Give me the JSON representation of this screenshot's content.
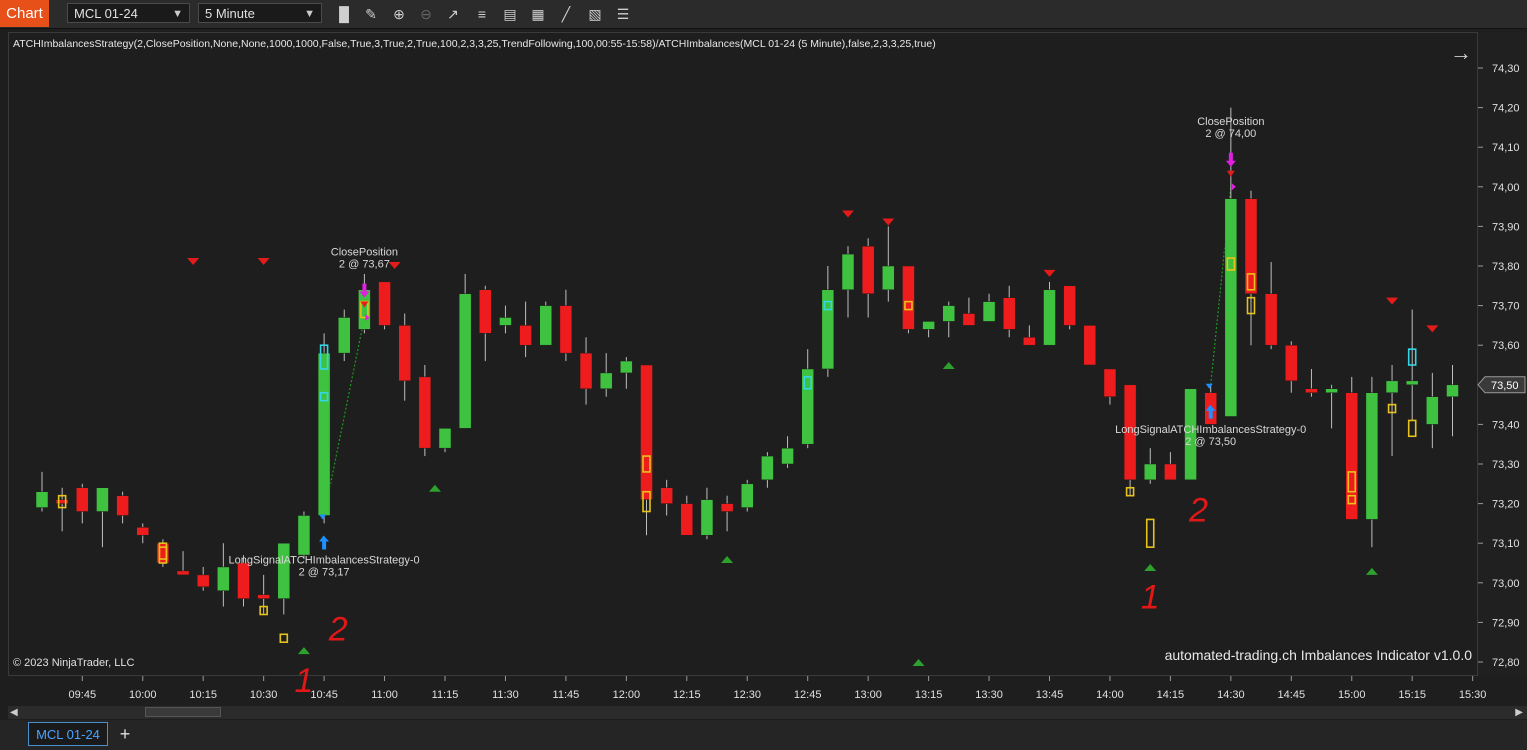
{
  "toolbar": {
    "chart_tab_label": "Chart",
    "instrument_value": "MCL 01-24",
    "interval_value": "5 Minute",
    "tools": [
      "bar-type-icon",
      "draw-pencil-icon",
      "zoom-in-icon",
      "zoom-out-icon",
      "pointer-icon",
      "properties-icon",
      "data-box-icon",
      "indicators-icon",
      "strategies-icon",
      "templates-icon",
      "more-menu-icon"
    ]
  },
  "chart_header": {
    "strategy_title": "ATCHImbalancesStrategy(2,ClosePosition,None,None,1000,1000,False,True,3,True,2,True,100,2,3,3,25,TrendFollowing,100,00:55-15:58)/ATCHImbalances(MCL 01-24 (5 Minute),false,2,3,3,25,true)"
  },
  "footer": {
    "copyright": "© 2023 NinjaTrader, LLC",
    "indicator_label": "automated-trading.ch Imbalances Indicator v1.0.0"
  },
  "bottom_tabs": {
    "instrument_tab": "MCL 01-24",
    "add_tab": "+"
  },
  "colors": {
    "up": "#3fc23f",
    "down": "#ee1c1c",
    "imbalance_yellow": "#e6c21a",
    "imbalance_cyan": "#33d6e6",
    "signal_up": "#1e90ff",
    "exit_marker": "#e21ee2",
    "triangle_down": "#e31b1b",
    "triangle_up": "#2ea02e",
    "annotation_red": "#e01818"
  },
  "chart_data": {
    "type": "candlestick",
    "interval": "5 Minute",
    "instrument": "MCL 01-24",
    "ylim": [
      72.77,
      74.35
    ],
    "y_ticks": [
      "74,30",
      "74,20",
      "74,10",
      "74,00",
      "73,90",
      "73,80",
      "73,70",
      "73,60",
      "73,50",
      "73,40",
      "73,30",
      "73,20",
      "73,10",
      "73,00",
      "72,90",
      "72,80"
    ],
    "last_price_label": "73,50",
    "last_price": 73.5,
    "x_ticks": [
      "09:45",
      "10:00",
      "10:15",
      "10:30",
      "10:45",
      "11:00",
      "11:15",
      "11:30",
      "11:45",
      "12:00",
      "12:15",
      "12:30",
      "12:45",
      "13:00",
      "13:15",
      "13:30",
      "13:45",
      "14:00",
      "14:15",
      "14:30",
      "14:45",
      "15:00",
      "15:15",
      "15:30"
    ],
    "first_bar_time": "09:35",
    "bar_minutes": 5,
    "candles": [
      {
        "o": 73.19,
        "h": 73.28,
        "l": 73.18,
        "c": 73.23
      },
      {
        "o": 73.21,
        "h": 73.24,
        "l": 73.13,
        "c": 73.2
      },
      {
        "o": 73.24,
        "h": 73.25,
        "l": 73.15,
        "c": 73.18
      },
      {
        "o": 73.18,
        "h": 73.23,
        "l": 73.09,
        "c": 73.24
      },
      {
        "o": 73.22,
        "h": 73.23,
        "l": 73.15,
        "c": 73.17
      },
      {
        "o": 73.14,
        "h": 73.15,
        "l": 73.1,
        "c": 73.12
      },
      {
        "o": 73.1,
        "h": 73.11,
        "l": 73.04,
        "c": 73.05
      },
      {
        "o": 73.03,
        "h": 73.08,
        "l": 73.02,
        "c": 73.02
      },
      {
        "o": 73.02,
        "h": 73.04,
        "l": 72.98,
        "c": 72.99
      },
      {
        "o": 72.98,
        "h": 73.1,
        "l": 72.94,
        "c": 73.04
      },
      {
        "o": 73.05,
        "h": 73.07,
        "l": 72.94,
        "c": 72.96
      },
      {
        "o": 72.97,
        "h": 73.02,
        "l": 72.92,
        "c": 72.96
      },
      {
        "o": 72.96,
        "h": 73.1,
        "l": 72.92,
        "c": 73.1
      },
      {
        "o": 73.07,
        "h": 73.18,
        "l": 73.06,
        "c": 73.17
      },
      {
        "o": 73.17,
        "h": 73.63,
        "l": 73.15,
        "c": 73.58
      },
      {
        "o": 73.58,
        "h": 73.69,
        "l": 73.56,
        "c": 73.67
      },
      {
        "o": 73.64,
        "h": 73.78,
        "l": 73.63,
        "c": 73.74
      },
      {
        "o": 73.76,
        "h": 73.76,
        "l": 73.64,
        "c": 73.65
      },
      {
        "o": 73.65,
        "h": 73.68,
        "l": 73.46,
        "c": 73.51
      },
      {
        "o": 73.52,
        "h": 73.55,
        "l": 73.32,
        "c": 73.34
      },
      {
        "o": 73.34,
        "h": 73.39,
        "l": 73.33,
        "c": 73.39
      },
      {
        "o": 73.39,
        "h": 73.78,
        "l": 73.39,
        "c": 73.73
      },
      {
        "o": 73.74,
        "h": 73.75,
        "l": 73.56,
        "c": 73.63
      },
      {
        "o": 73.65,
        "h": 73.7,
        "l": 73.63,
        "c": 73.67
      },
      {
        "o": 73.65,
        "h": 73.71,
        "l": 73.57,
        "c": 73.6
      },
      {
        "o": 73.6,
        "h": 73.71,
        "l": 73.6,
        "c": 73.7
      },
      {
        "o": 73.7,
        "h": 73.74,
        "l": 73.56,
        "c": 73.58
      },
      {
        "o": 73.58,
        "h": 73.62,
        "l": 73.45,
        "c": 73.49
      },
      {
        "o": 73.49,
        "h": 73.58,
        "l": 73.47,
        "c": 73.53
      },
      {
        "o": 73.53,
        "h": 73.57,
        "l": 73.49,
        "c": 73.56
      },
      {
        "o": 73.55,
        "h": 73.55,
        "l": 73.12,
        "c": 73.21
      },
      {
        "o": 73.24,
        "h": 73.26,
        "l": 73.17,
        "c": 73.2
      },
      {
        "o": 73.2,
        "h": 73.22,
        "l": 73.15,
        "c": 73.12
      },
      {
        "o": 73.12,
        "h": 73.24,
        "l": 73.11,
        "c": 73.21
      },
      {
        "o": 73.2,
        "h": 73.22,
        "l": 73.13,
        "c": 73.18
      },
      {
        "o": 73.19,
        "h": 73.26,
        "l": 73.18,
        "c": 73.25
      },
      {
        "o": 73.26,
        "h": 73.33,
        "l": 73.24,
        "c": 73.32
      },
      {
        "o": 73.3,
        "h": 73.37,
        "l": 73.29,
        "c": 73.34
      },
      {
        "o": 73.35,
        "h": 73.59,
        "l": 73.34,
        "c": 73.54
      },
      {
        "o": 73.54,
        "h": 73.8,
        "l": 73.52,
        "c": 73.74
      },
      {
        "o": 73.74,
        "h": 73.85,
        "l": 73.67,
        "c": 73.83
      },
      {
        "o": 73.85,
        "h": 73.87,
        "l": 73.67,
        "c": 73.73
      },
      {
        "o": 73.74,
        "h": 73.9,
        "l": 73.71,
        "c": 73.8
      },
      {
        "o": 73.8,
        "h": 73.8,
        "l": 73.63,
        "c": 73.64
      },
      {
        "o": 73.64,
        "h": 73.66,
        "l": 73.62,
        "c": 73.66
      },
      {
        "o": 73.66,
        "h": 73.71,
        "l": 73.62,
        "c": 73.7
      },
      {
        "o": 73.68,
        "h": 73.72,
        "l": 73.65,
        "c": 73.65
      },
      {
        "o": 73.66,
        "h": 73.73,
        "l": 73.66,
        "c": 73.71
      },
      {
        "o": 73.72,
        "h": 73.75,
        "l": 73.62,
        "c": 73.64
      },
      {
        "o": 73.62,
        "h": 73.65,
        "l": 73.61,
        "c": 73.6
      },
      {
        "o": 73.6,
        "h": 73.76,
        "l": 73.6,
        "c": 73.74
      },
      {
        "o": 73.75,
        "h": 73.75,
        "l": 73.64,
        "c": 73.65
      },
      {
        "o": 73.65,
        "h": 73.65,
        "l": 73.55,
        "c": 73.55
      },
      {
        "o": 73.54,
        "h": 73.54,
        "l": 73.45,
        "c": 73.47
      },
      {
        "o": 73.5,
        "h": 73.5,
        "l": 73.22,
        "c": 73.26
      },
      {
        "o": 73.26,
        "h": 73.34,
        "l": 73.25,
        "c": 73.3
      },
      {
        "o": 73.3,
        "h": 73.33,
        "l": 73.26,
        "c": 73.26
      },
      {
        "o": 73.26,
        "h": 73.49,
        "l": 73.26,
        "c": 73.49
      },
      {
        "o": 73.48,
        "h": 73.5,
        "l": 73.4,
        "c": 73.4
      },
      {
        "o": 73.42,
        "h": 74.2,
        "l": 73.42,
        "c": 73.97
      },
      {
        "o": 73.97,
        "h": 73.99,
        "l": 73.6,
        "c": 73.73
      },
      {
        "o": 73.73,
        "h": 73.81,
        "l": 73.59,
        "c": 73.6
      },
      {
        "o": 73.6,
        "h": 73.61,
        "l": 73.48,
        "c": 73.51
      },
      {
        "o": 73.49,
        "h": 73.54,
        "l": 73.47,
        "c": 73.48
      },
      {
        "o": 73.48,
        "h": 73.5,
        "l": 73.39,
        "c": 73.49
      },
      {
        "o": 73.48,
        "h": 73.52,
        "l": 73.16,
        "c": 73.16
      },
      {
        "o": 73.16,
        "h": 73.52,
        "l": 73.09,
        "c": 73.48
      },
      {
        "o": 73.48,
        "h": 73.55,
        "l": 73.32,
        "c": 73.51
      },
      {
        "o": 73.5,
        "h": 73.69,
        "l": 73.41,
        "c": 73.51
      },
      {
        "o": 73.4,
        "h": 73.53,
        "l": 73.34,
        "c": 73.47
      },
      {
        "o": 73.47,
        "h": 73.55,
        "l": 73.37,
        "c": 73.5
      }
    ],
    "imbalance_boxes": [
      {
        "bar": 1,
        "lo": 73.19,
        "hi": 73.22,
        "color": "yellow"
      },
      {
        "bar": 6,
        "lo": 73.05,
        "hi": 73.09,
        "color": "yellow"
      },
      {
        "bar": 6,
        "lo": 73.06,
        "hi": 73.1,
        "color": "yellow"
      },
      {
        "bar": 11,
        "lo": 72.92,
        "hi": 72.94,
        "color": "yellow"
      },
      {
        "bar": 12,
        "lo": 72.85,
        "hi": 72.87,
        "color": "yellow"
      },
      {
        "bar": 14,
        "lo": 73.54,
        "hi": 73.6,
        "color": "cyan"
      },
      {
        "bar": 14,
        "lo": 73.46,
        "hi": 73.48,
        "color": "cyan"
      },
      {
        "bar": 16,
        "lo": 73.67,
        "hi": 73.71,
        "color": "yellow"
      },
      {
        "bar": 30,
        "lo": 73.28,
        "hi": 73.32,
        "color": "yellow"
      },
      {
        "bar": 30,
        "lo": 73.18,
        "hi": 73.23,
        "color": "yellow"
      },
      {
        "bar": 39,
        "lo": 73.69,
        "hi": 73.71,
        "color": "cyan"
      },
      {
        "bar": 38,
        "lo": 73.49,
        "hi": 73.52,
        "color": "cyan"
      },
      {
        "bar": 43,
        "lo": 73.69,
        "hi": 73.71,
        "color": "yellow"
      },
      {
        "bar": 54,
        "lo": 73.22,
        "hi": 73.24,
        "color": "yellow"
      },
      {
        "bar": 55,
        "lo": 73.09,
        "hi": 73.16,
        "color": "yellow"
      },
      {
        "bar": 59,
        "lo": 73.79,
        "hi": 73.82,
        "color": "yellow"
      },
      {
        "bar": 60,
        "lo": 73.74,
        "hi": 73.78,
        "color": "yellow"
      },
      {
        "bar": 60,
        "lo": 73.68,
        "hi": 73.72,
        "color": "yellow"
      },
      {
        "bar": 65,
        "lo": 73.28,
        "hi": 73.23,
        "color": "yellow"
      },
      {
        "bar": 65,
        "lo": 73.2,
        "hi": 73.22,
        "color": "yellow"
      },
      {
        "bar": 67,
        "lo": 73.43,
        "hi": 73.45,
        "color": "yellow"
      },
      {
        "bar": 68,
        "lo": 73.55,
        "hi": 73.59,
        "color": "cyan"
      },
      {
        "bar": 68,
        "lo": 73.37,
        "hi": 73.41,
        "color": "yellow"
      }
    ],
    "swing_markers": [
      {
        "bar": 7.5,
        "price": 73.81,
        "dir": "down"
      },
      {
        "bar": 17.5,
        "price": 73.8,
        "dir": "down"
      },
      {
        "bar": 11,
        "price": 73.81,
        "dir": "down"
      },
      {
        "bar": 40,
        "price": 73.93,
        "dir": "down"
      },
      {
        "bar": 42,
        "price": 73.91,
        "dir": "down"
      },
      {
        "bar": 50,
        "price": 73.78,
        "dir": "down"
      },
      {
        "bar": 67,
        "price": 73.71,
        "dir": "down"
      },
      {
        "bar": 69,
        "price": 73.64,
        "dir": "down"
      },
      {
        "bar": 13,
        "price": 72.83,
        "dir": "up"
      },
      {
        "bar": 19.5,
        "price": 73.24,
        "dir": "up"
      },
      {
        "bar": 34,
        "price": 73.06,
        "dir": "up"
      },
      {
        "bar": 43.5,
        "price": 72.8,
        "dir": "up"
      },
      {
        "bar": 45,
        "price": 73.55,
        "dir": "up"
      },
      {
        "bar": 55,
        "price": 73.04,
        "dir": "up"
      },
      {
        "bar": 66,
        "price": 73.03,
        "dir": "up"
      }
    ],
    "trades": [
      {
        "entry_bar": 14,
        "entry_price": 73.17,
        "entry_label_1": "LongSignalATCHImbalancesStrategy-0",
        "entry_label_2": "2 @ 73,17",
        "exit_bar": 16,
        "exit_price": 73.67,
        "exit_label_1": "ClosePosition",
        "exit_label_2": "2 @ 73,67"
      },
      {
        "entry_bar": 58,
        "entry_price": 73.5,
        "entry_label_1": "LongSignalATCHImbalancesStrategy-0",
        "entry_label_2": "2 @ 73,50",
        "exit_bar": 59,
        "exit_price": 74.0,
        "exit_label_1": "ClosePosition",
        "exit_label_2": "2 @ 74,00"
      }
    ],
    "handwritten_annotations": [
      {
        "text": "1",
        "bar": 13,
        "price": 72.77
      },
      {
        "text": "2",
        "bar": 14.7,
        "price": 72.9
      },
      {
        "text": "1",
        "bar": 55,
        "price": 72.98
      },
      {
        "text": "2",
        "bar": 57.4,
        "price": 73.2
      }
    ]
  }
}
